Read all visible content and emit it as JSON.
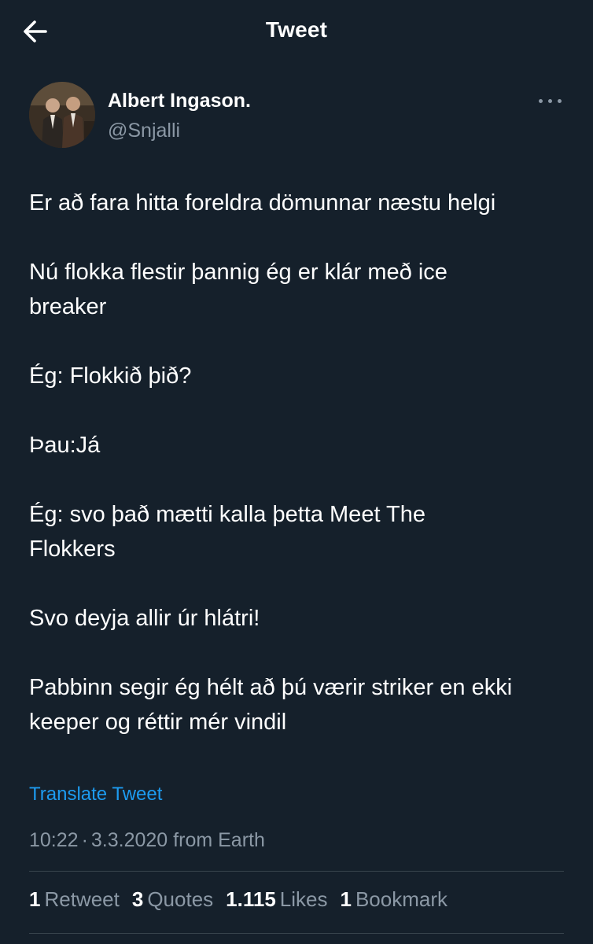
{
  "header": {
    "title": "Tweet",
    "back_icon": "arrow-left-icon"
  },
  "author": {
    "display_name": "Albert Ingason.",
    "handle": "@Snjalli",
    "more_icon": "more-horizontal-icon"
  },
  "tweet": {
    "paragraphs": [
      "Er að fara hitta foreldra dömunnar næstu helgi",
      "Nú flokka flestir þannig ég er klár með ice\nbreaker",
      "Ég: Flokkið þið?",
      "Þau:Já",
      "Ég: svo það mætti kalla þetta Meet The\nFlokkers",
      "Svo deyja allir úr hlátri!",
      "Pabbinn segir ég hélt að þú værir striker en ekki\nkeeper og réttir mér vindil"
    ],
    "translate_label": "Translate Tweet",
    "time": "10:22",
    "separator": "·",
    "date": "3.3.2020",
    "source": "from Earth"
  },
  "stats": [
    {
      "count": "1",
      "label": "Retweet"
    },
    {
      "count": "3",
      "label": "Quotes"
    },
    {
      "count": "1.115",
      "label": "Likes"
    },
    {
      "count": "1",
      "label": "Bookmark"
    }
  ],
  "colors": {
    "background": "#15202b",
    "text": "#ffffff",
    "secondary": "#8b98a5",
    "link": "#1d9bf0",
    "divider": "#38444d"
  }
}
